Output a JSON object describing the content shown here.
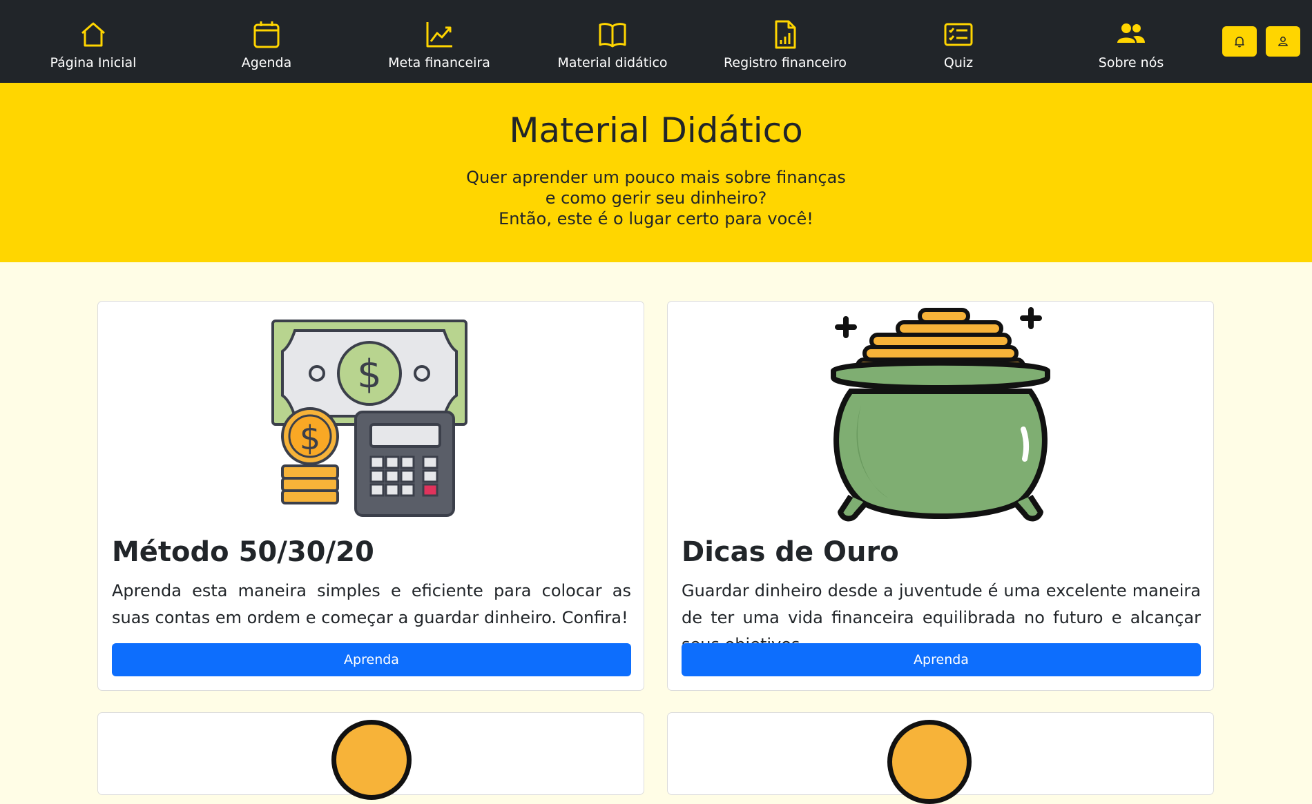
{
  "nav": {
    "items": [
      {
        "label": "Página Inicial",
        "icon": "home-icon"
      },
      {
        "label": "Agenda",
        "icon": "calendar-icon"
      },
      {
        "label": "Meta financeira",
        "icon": "chart-line-icon"
      },
      {
        "label": "Material didático",
        "icon": "book-icon"
      },
      {
        "label": "Registro financeiro",
        "icon": "document-chart-icon"
      },
      {
        "label": "Quiz",
        "icon": "checklist-icon"
      },
      {
        "label": "Sobre nós",
        "icon": "people-icon"
      }
    ],
    "bell_icon": "bell-icon",
    "user_icon": "user-icon",
    "accent": "#ffd500"
  },
  "hero": {
    "title": "Material Didático",
    "line1": "Quer aprender um pouco mais sobre finanças",
    "line2": "e como gerir seu dinheiro?",
    "line3": "Então, este é o lugar certo para você!"
  },
  "cards": [
    {
      "title": "Método 50/30/20",
      "text": "Aprenda esta maneira simples e eficiente para colocar as suas contas em ordem e começar a guardar dinheiro. Confira!",
      "button": "Aprenda",
      "image": "money-calculator-illustration"
    },
    {
      "title": "Dicas de Ouro",
      "text": "Guardar dinheiro desde a juventude é uma excelente maneira de ter uma vida financeira equilibrada no futuro e alcançar seus objetivos.",
      "button": "Aprenda",
      "image": "pot-of-gold-illustration"
    }
  ],
  "colors": {
    "navbar": "#212529",
    "hero": "#ffd600",
    "page_bg": "#fffde6",
    "primary_button": "#0d6efd"
  }
}
